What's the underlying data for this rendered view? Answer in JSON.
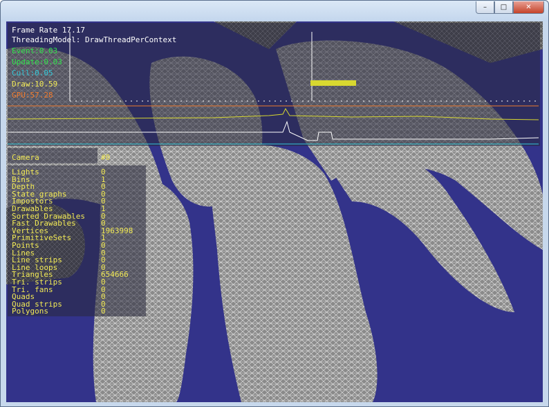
{
  "window": {
    "controls": {
      "minimize": "–",
      "maximize": "□",
      "close": "✕"
    }
  },
  "overlay": {
    "frame_rate": "Frame Rate 17.17",
    "threading_model": "ThreadingModel: DrawThreadPerContext",
    "timings": [
      {
        "label": "Event:0.03",
        "color": "#2fe24a"
      },
      {
        "label": "Update:0.03",
        "color": "#2fe24a"
      },
      {
        "label": "Cull:0.05",
        "color": "#32c8d8"
      },
      {
        "label": "Draw:10.59",
        "color": "#f2ea55"
      },
      {
        "label": "GPU:57.28",
        "color": "#f07a2c"
      }
    ],
    "camera": {
      "label": "Camera",
      "value": "#0"
    },
    "stats": [
      {
        "label": "Lights",
        "value": "0"
      },
      {
        "label": "Bins",
        "value": "1"
      },
      {
        "label": "Depth",
        "value": "0"
      },
      {
        "label": "State graphs",
        "value": "0"
      },
      {
        "label": "Impostors",
        "value": "0"
      },
      {
        "label": "Drawables",
        "value": "1"
      },
      {
        "label": "Sorted Drawables",
        "value": "0"
      },
      {
        "label": "Fast Drawables",
        "value": "0"
      },
      {
        "label": "Vertices",
        "value": "1963998"
      },
      {
        "label": "PrimitiveSets",
        "value": "1"
      },
      {
        "label": "Points",
        "value": "0"
      },
      {
        "label": "Lines",
        "value": "0"
      },
      {
        "label": "Line strips",
        "value": "0"
      },
      {
        "label": "Line loops",
        "value": "0"
      },
      {
        "label": "Triangles",
        "value": "654666"
      },
      {
        "label": "Tri. strips",
        "value": "0"
      },
      {
        "label": "Tri. fans",
        "value": "0"
      },
      {
        "label": "Quads",
        "value": "0"
      },
      {
        "label": "Quad strips",
        "value": "0"
      },
      {
        "label": "Polygons",
        "value": "0"
      }
    ]
  },
  "colors": {
    "background": "#33338a",
    "mesh": "#c8c8c8",
    "stat_text": "#f2ea55",
    "frame_text": "#ffffff"
  }
}
